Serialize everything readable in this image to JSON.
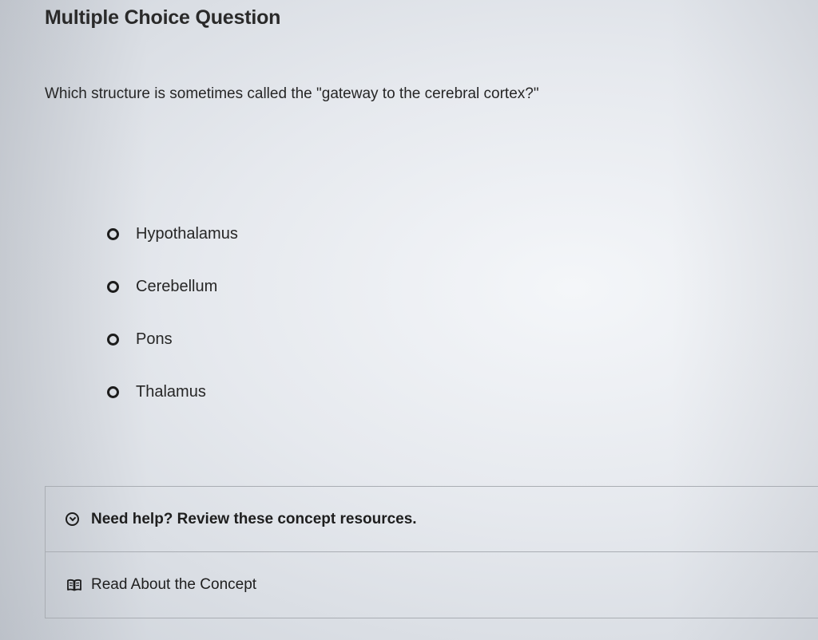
{
  "page": {
    "heading": "Multiple Choice Question",
    "question": "Which structure is sometimes called the \"gateway to the cerebral cortex?\""
  },
  "options": [
    {
      "label": "Hypothalamus",
      "selected": false
    },
    {
      "label": "Cerebellum",
      "selected": false
    },
    {
      "label": "Pons",
      "selected": false
    },
    {
      "label": "Thalamus",
      "selected": false
    }
  ],
  "help": {
    "toggle_icon": "chevron-down-circle-icon",
    "title": "Need help? Review these concept resources.",
    "resource_icon": "book-icon",
    "resource_label": "Read About the Concept"
  }
}
